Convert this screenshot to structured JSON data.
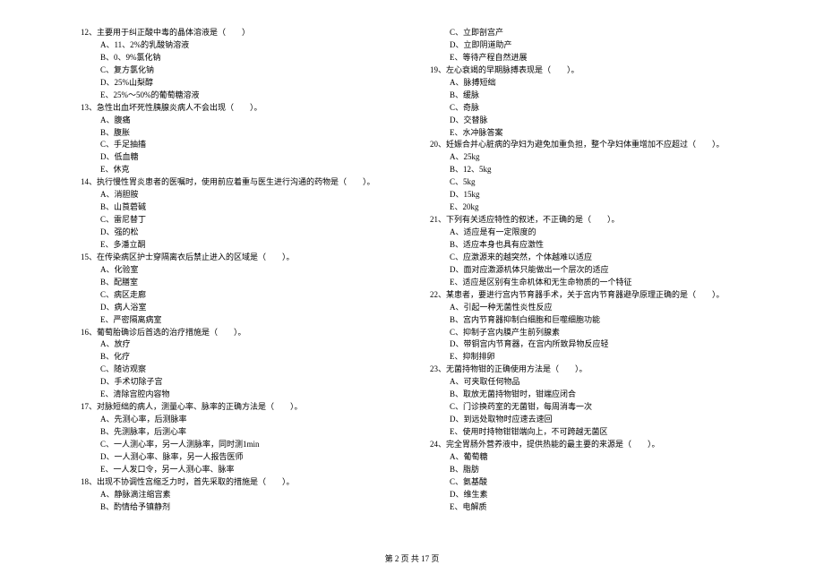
{
  "left": [
    {
      "t": "q",
      "n": "12、",
      "text": "主要用于纠正酸中毒的晶体溶液是（　　）"
    },
    {
      "t": "o",
      "l": "A、",
      "text": "11、2%的乳酸钠溶液"
    },
    {
      "t": "o",
      "l": "B、",
      "text": "0、9%氯化钠"
    },
    {
      "t": "o",
      "l": "C、",
      "text": "复方氯化钠"
    },
    {
      "t": "o",
      "l": "D、",
      "text": "25%山梨醇"
    },
    {
      "t": "o",
      "l": "E、",
      "text": "25%～50%的葡萄糖溶液"
    },
    {
      "t": "q",
      "n": "13、",
      "text": "急性出血坏死性胰腺炎病人不会出现（　　）。"
    },
    {
      "t": "o",
      "l": "A、",
      "text": "腹痛"
    },
    {
      "t": "o",
      "l": "B、",
      "text": "腹胀"
    },
    {
      "t": "o",
      "l": "C、",
      "text": "手足抽搐"
    },
    {
      "t": "o",
      "l": "D、",
      "text": "低血糖"
    },
    {
      "t": "o",
      "l": "E、",
      "text": "休克"
    },
    {
      "t": "q",
      "n": "14、",
      "text": "执行慢性胃炎患者的医嘱时，使用前应着重与医生进行沟通的药物是（　　）。"
    },
    {
      "t": "o",
      "l": "A、",
      "text": "消胆胺"
    },
    {
      "t": "o",
      "l": "B、",
      "text": "山莨菪碱"
    },
    {
      "t": "o",
      "l": "C、",
      "text": "雷尼替丁"
    },
    {
      "t": "o",
      "l": "D、",
      "text": "强的松"
    },
    {
      "t": "o",
      "l": "E、",
      "text": "多潘立酮"
    },
    {
      "t": "q",
      "n": "15、",
      "text": "在传染病区护士穿隔离衣后禁止进入的区域是（　　）。"
    },
    {
      "t": "o",
      "l": "A、",
      "text": "化验室"
    },
    {
      "t": "o",
      "l": "B、",
      "text": "配膳室"
    },
    {
      "t": "o",
      "l": "C、",
      "text": "病区走廊"
    },
    {
      "t": "o",
      "l": "D、",
      "text": "病人浴室"
    },
    {
      "t": "o",
      "l": "E、",
      "text": "严密隔离病室"
    },
    {
      "t": "q",
      "n": "16、",
      "text": "葡萄胎确诊后首选的治疗措施是（　　）。"
    },
    {
      "t": "o",
      "l": "A、",
      "text": "放疗"
    },
    {
      "t": "o",
      "l": "B、",
      "text": "化疗"
    },
    {
      "t": "o",
      "l": "C、",
      "text": "随访观察"
    },
    {
      "t": "o",
      "l": "D、",
      "text": "手术切除子宫"
    },
    {
      "t": "o",
      "l": "E、",
      "text": "清除宫腔内容物"
    },
    {
      "t": "q",
      "n": "17、",
      "text": "对脉短绌的病人，测量心率、脉率的正确方法是（　　）。"
    },
    {
      "t": "o",
      "l": "A、",
      "text": "先测心率，后测脉率"
    },
    {
      "t": "o",
      "l": "B、",
      "text": "先测脉率，后测心率"
    },
    {
      "t": "o",
      "l": "C、",
      "text": "一人测心率，另一人测脉率，同时测1min"
    },
    {
      "t": "o",
      "l": "D、",
      "text": "一人测心率、脉率，另一人报告医师"
    },
    {
      "t": "o",
      "l": "E、",
      "text": "一人发口令，另一人测心率、脉率"
    },
    {
      "t": "q",
      "n": "18、",
      "text": "出现不协调性宫缩乏力时，首先采取的措施是（　　）。"
    },
    {
      "t": "o",
      "l": "A、",
      "text": "静脉滴注缩宫素"
    },
    {
      "t": "o",
      "l": "B、",
      "text": "酌情给予镇静剂"
    }
  ],
  "right": [
    {
      "t": "o",
      "l": "C、",
      "text": "立即剖宫产"
    },
    {
      "t": "o",
      "l": "D、",
      "text": "立即阴道助产"
    },
    {
      "t": "o",
      "l": "E、",
      "text": "等待产程自然进展"
    },
    {
      "t": "q",
      "n": "19、",
      "text": "左心衰竭的早期脉搏表现是（　　）。"
    },
    {
      "t": "o",
      "l": "A、",
      "text": "脉搏短绌"
    },
    {
      "t": "o",
      "l": "B、",
      "text": "缓脉"
    },
    {
      "t": "o",
      "l": "C、",
      "text": "奇脉"
    },
    {
      "t": "o",
      "l": "D、",
      "text": "交替脉"
    },
    {
      "t": "o",
      "l": "E、",
      "text": "水冲脉答案"
    },
    {
      "t": "q",
      "n": "20、",
      "text": "妊娠合并心脏病的孕妇为避免加重负担，整个孕妇体重增加不应超过（　　）。"
    },
    {
      "t": "o",
      "l": "A、",
      "text": "25kg"
    },
    {
      "t": "o",
      "l": "B、",
      "text": "12、5kg"
    },
    {
      "t": "o",
      "l": "C、",
      "text": "5kg"
    },
    {
      "t": "o",
      "l": "D、",
      "text": "15kg"
    },
    {
      "t": "o",
      "l": "E、",
      "text": "20kg"
    },
    {
      "t": "q",
      "n": "21、",
      "text": "下列有关适应特性的叙述，不正确的是（　　）。"
    },
    {
      "t": "o",
      "l": "A、",
      "text": "适应是有一定限度的"
    },
    {
      "t": "o",
      "l": "B、",
      "text": "适应本身也具有应激性"
    },
    {
      "t": "o",
      "l": "C、",
      "text": "应激源来的越突然，个体越难以适应"
    },
    {
      "t": "o",
      "l": "D、",
      "text": "面对应激源机体只能做出一个层次的适应"
    },
    {
      "t": "o",
      "l": "E、",
      "text": "适应是区别有生命机体和无生命物质的一个特征"
    },
    {
      "t": "q",
      "n": "22、",
      "text": "某患者，要进行宫内节育器手术，关于宫内节育器避孕原理正确的是（　　）。"
    },
    {
      "t": "o",
      "l": "A、",
      "text": "引起一种无菌性炎性反应"
    },
    {
      "t": "o",
      "l": "B、",
      "text": "宫内节育器抑制白细胞和巨噬细胞功能"
    },
    {
      "t": "o",
      "l": "C、",
      "text": "抑制子宫内膜产生前列腺素"
    },
    {
      "t": "o",
      "l": "D、",
      "text": "带铜宫内节育器，在宫内所致异物反应轻"
    },
    {
      "t": "o",
      "l": "E、",
      "text": "抑制排卵"
    },
    {
      "t": "q",
      "n": "23、",
      "text": "无菌持物钳的正确使用方法是（　　）。"
    },
    {
      "t": "o",
      "l": "A、",
      "text": "可夹取任何物品"
    },
    {
      "t": "o",
      "l": "B、",
      "text": "取放无菌持物钳时，钳端应闭合"
    },
    {
      "t": "o",
      "l": "C、",
      "text": "门诊换药室的无菌钳，每周消毒一次"
    },
    {
      "t": "o",
      "l": "D、",
      "text": "到远处取物时应速去速回"
    },
    {
      "t": "o",
      "l": "E、",
      "text": "使用时持物钳钳端向上，不可跨越无菌区"
    },
    {
      "t": "q",
      "n": "24、",
      "text": "完全胃肠外营养液中，提供热能的最主要的来源是（　　）。"
    },
    {
      "t": "o",
      "l": "A、",
      "text": "葡萄糖"
    },
    {
      "t": "o",
      "l": "B、",
      "text": "脂肪"
    },
    {
      "t": "o",
      "l": "C、",
      "text": "氨基酸"
    },
    {
      "t": "o",
      "l": "D、",
      "text": "维生素"
    },
    {
      "t": "o",
      "l": "E、",
      "text": "电解质"
    }
  ],
  "footer": "第 2 页 共 17 页"
}
